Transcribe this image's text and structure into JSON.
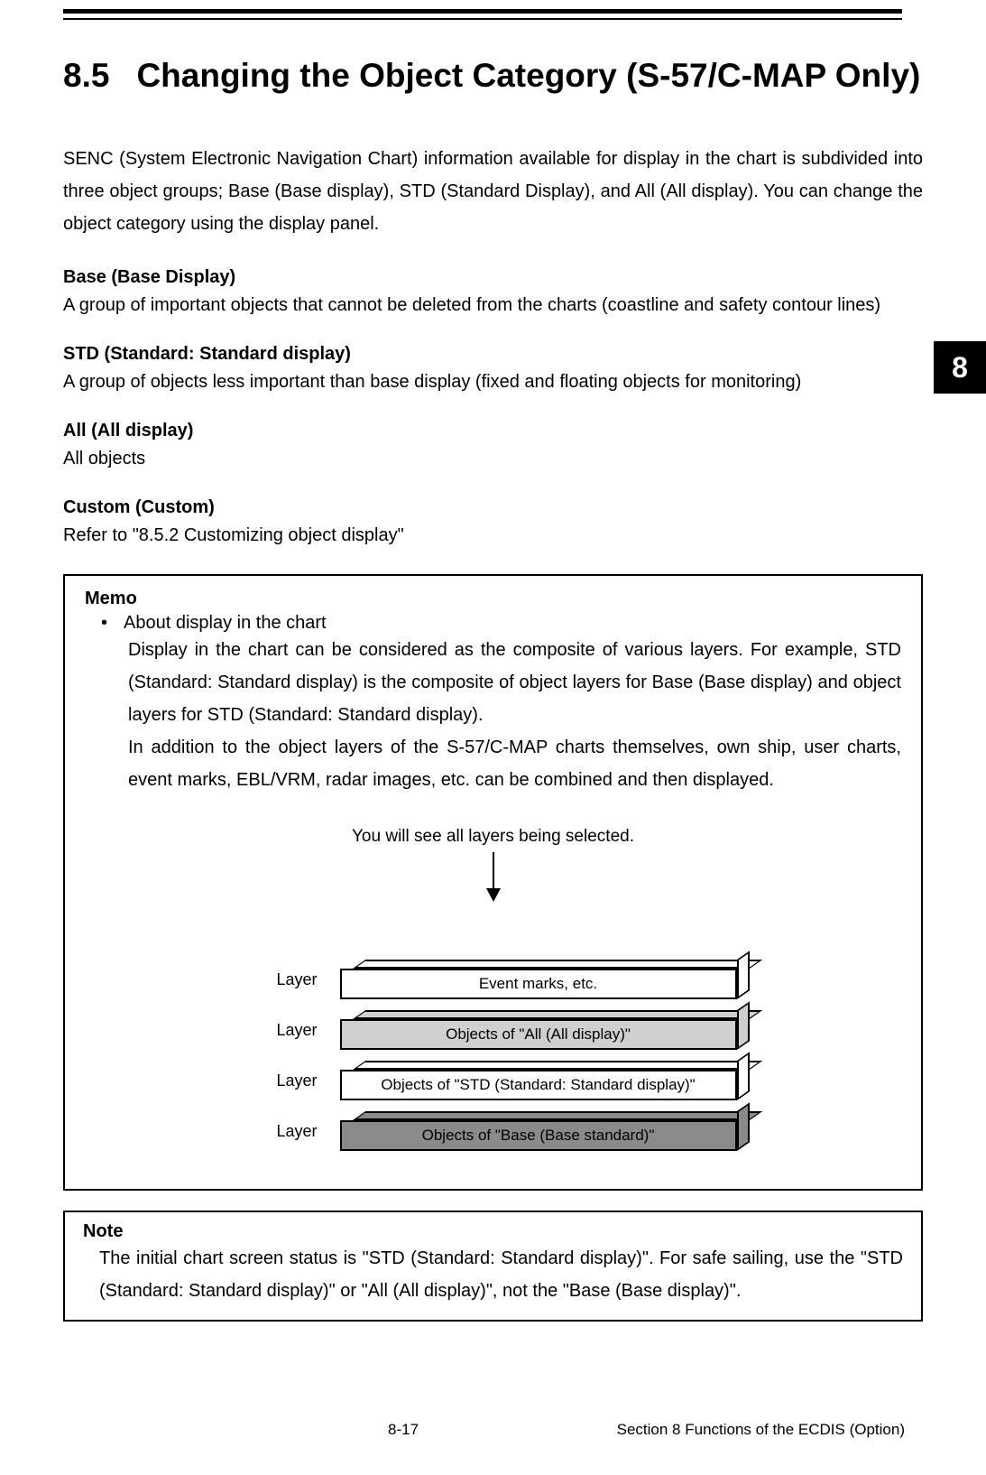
{
  "heading": {
    "number": "8.5",
    "title": "Changing the Object Category (S-57/C-MAP Only)"
  },
  "intro": "SENC (System Electronic Navigation Chart) information available for display in the chart is subdivided into three object groups; Base (Base display), STD (Standard Display), and All (All display). You can change the object category using the display panel.",
  "sections": {
    "base": {
      "title": "Base (Base Display)",
      "body": "A group of important objects that cannot be deleted from the charts (coastline and safety contour lines)"
    },
    "std": {
      "title": "STD (Standard: Standard display)",
      "body": "A group of objects less important than base display (fixed and floating objects for monitoring)"
    },
    "all": {
      "title": "All (All display)",
      "body": "All objects"
    },
    "custom": {
      "title": "Custom (Custom)",
      "body": "Refer to \"8.5.2 Customizing object display\""
    }
  },
  "side_tab": "8",
  "memo": {
    "title": "Memo",
    "bullet": "•",
    "bullet_text": "About display in the chart",
    "para1": "Display in the chart can be considered as the composite of various layers. For example, STD (Standard: Standard display) is the composite of object layers for Base (Base display) and object layers for STD (Standard: Standard display).",
    "para2": "In addition to the object layers of the S-57/C-MAP charts themselves, own ship, user charts, event marks, EBL/VRM, radar images, etc. can be combined and then displayed.",
    "diagram_caption": "You will see all layers being selected.",
    "layer_label": "Layer",
    "layers": {
      "l1": "Event marks, etc.",
      "l2": "Objects of \"All (All display)\"",
      "l3": "Objects of \"STD (Standard: Standard display)\"",
      "l4": "Objects of \"Base (Base standard)\""
    }
  },
  "note": {
    "title": "Note",
    "body": "The initial chart screen status is \"STD (Standard: Standard display)\". For safe sailing, use the \"STD (Standard: Standard display)\" or \"All (All display)\", not the \"Base (Base display)\"."
  },
  "footer": {
    "page": "8-17",
    "section": "Section 8   Functions of the ECDIS (Option)"
  }
}
